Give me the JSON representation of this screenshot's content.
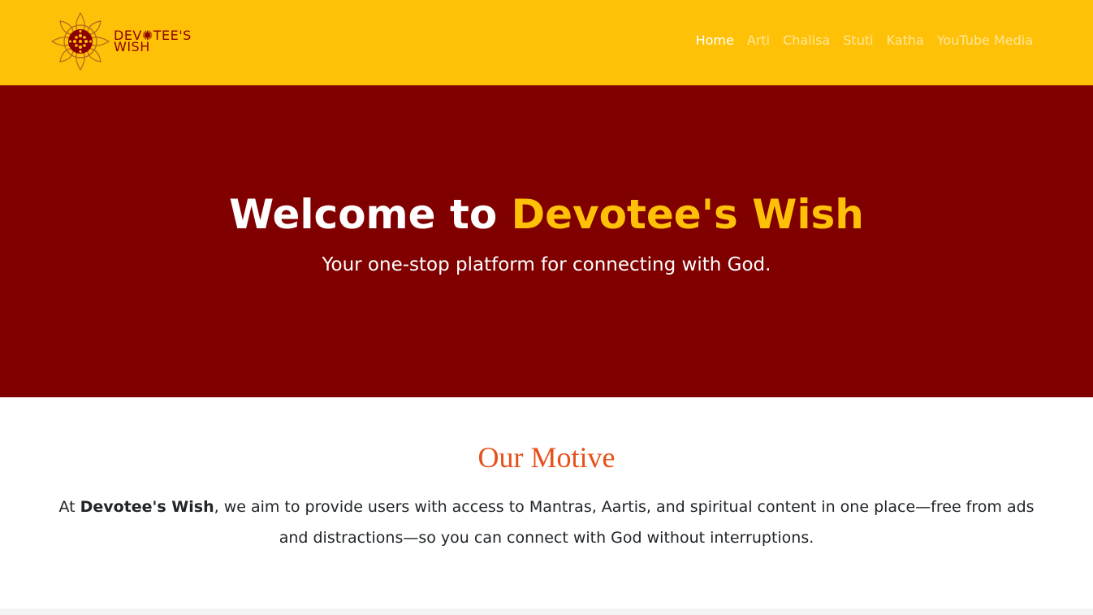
{
  "brand": {
    "line1": "DEV✺TEE'S",
    "line2": "WISH",
    "color": "#8b0000"
  },
  "nav": {
    "items": [
      {
        "label": "Home",
        "active": true
      },
      {
        "label": "Arti",
        "active": false
      },
      {
        "label": "Chalisa",
        "active": false
      },
      {
        "label": "Stuti",
        "active": false
      },
      {
        "label": "Katha",
        "active": false
      },
      {
        "label": "YouTube Media",
        "active": false
      }
    ]
  },
  "hero": {
    "title_prefix": "Welcome to ",
    "title_accent": "Devotee's Wish",
    "subtitle": "Your one-stop platform for connecting with God."
  },
  "motive": {
    "title": "Our Motive",
    "text_prefix": "At ",
    "text_bold": "Devotee's Wish",
    "text_rest": ", we aim to provide users with access to Mantras, Aartis, and spiritual content in one place—free from ads and distractions—so you can connect with God without interruptions."
  },
  "colors": {
    "navbar": "#ffc107",
    "hero": "#800000",
    "accent": "#ffc107",
    "motive_title": "#e8501a"
  }
}
